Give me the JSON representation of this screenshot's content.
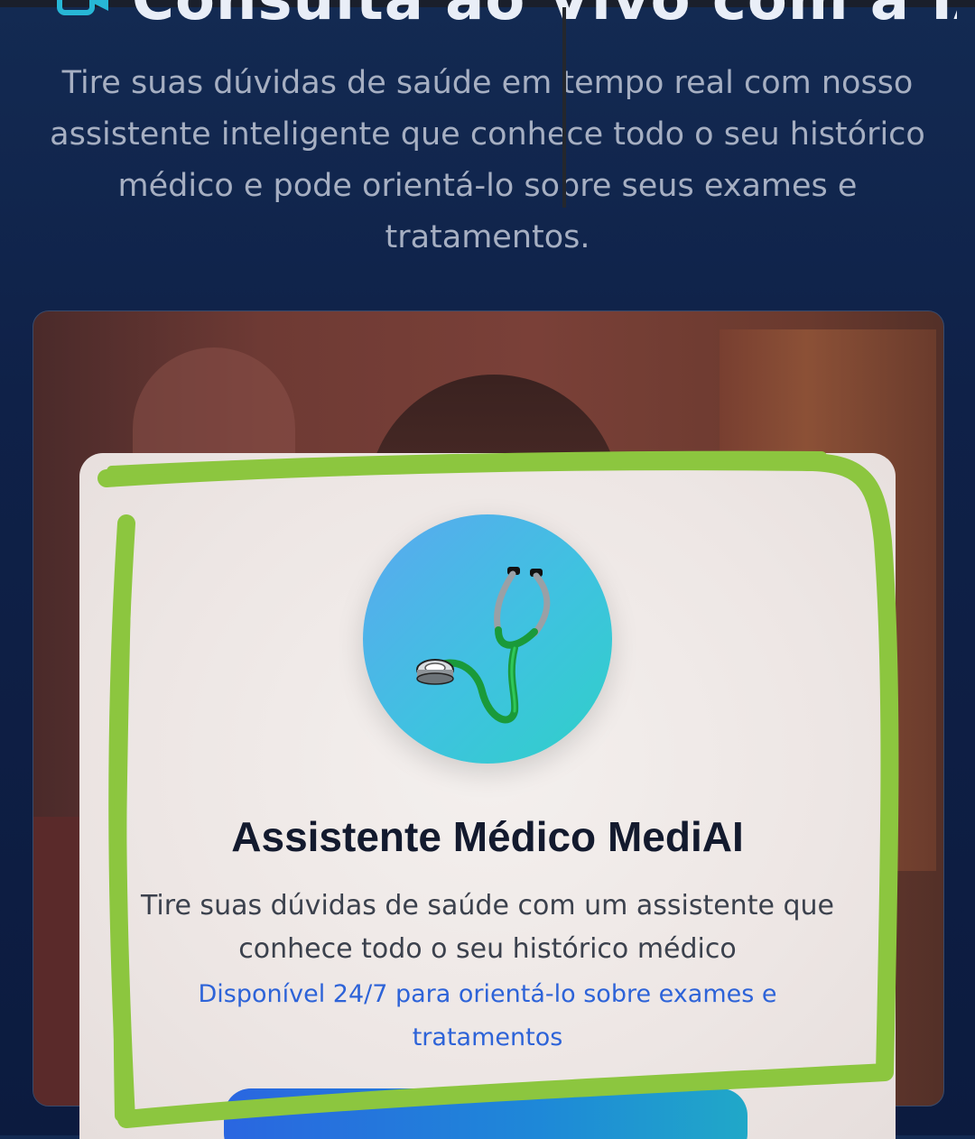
{
  "hero": {
    "title": "Consulta ao Vivo com a IA",
    "subtitle": "Tire suas dúvidas de saúde em tempo real com nosso assistente inteligente que conhece todo o seu histórico médico e pode orientá-lo sobre seus exames e tratamentos."
  },
  "card": {
    "title": "Assistente Médico MediAI",
    "description": "Tire suas dúvidas de saúde com um assistente que conhece todo o seu histórico médico",
    "availability": "Disponível 24/7 para orientá-lo sobre exames e tratamentos",
    "avatar_icon": "stethoscope-icon",
    "cta_label": ""
  },
  "colors": {
    "accent_blue": "#2d63d8",
    "avatar_gradient_start": "#5ba8f0",
    "avatar_gradient_end": "#2fd0c8",
    "highlight_marker": "#8cc63f",
    "background": "#0f2148"
  }
}
